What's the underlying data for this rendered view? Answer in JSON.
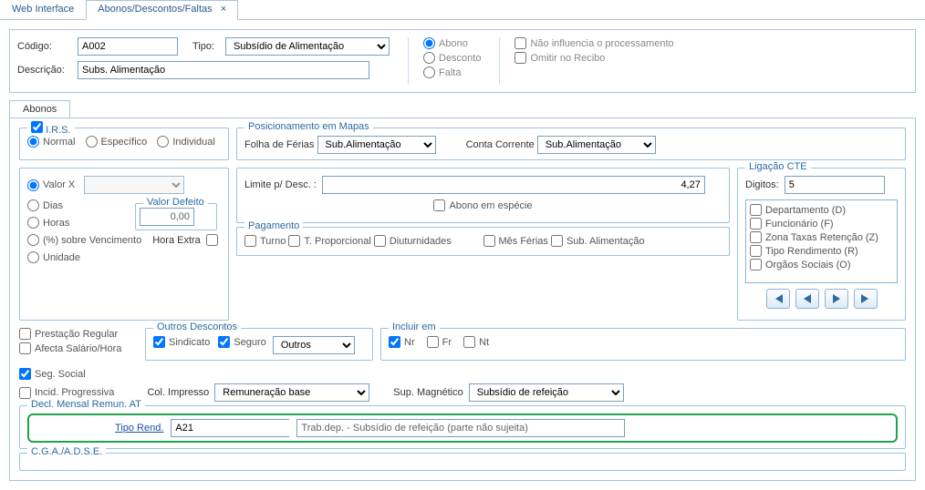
{
  "tabs": {
    "web": "Web Interface",
    "main": "Abonos/Descontos/Faltas"
  },
  "top": {
    "codigo_label": "Código:",
    "codigo_value": "A002",
    "tipo_label": "Tipo:",
    "tipo_value": "Subsídio de Alimentação",
    "descricao_label": "Descrição:",
    "descricao_value": "Subs. Alimentação",
    "rg_abono": "Abono",
    "rg_desconto": "Desconto",
    "rg_falta": "Falta",
    "chk_nao_infl": "Não influencia o processamento",
    "chk_omitir": "Omitir no Recibo"
  },
  "subtab": "Abonos",
  "irs": {
    "legend": "I.R.S.",
    "normal": "Normal",
    "especifico": "Específico",
    "individual": "Individual"
  },
  "mapas": {
    "legend": "Posicionamento em Mapas",
    "folha_label": "Folha de Férias",
    "folha_value": "Sub.Alimentação",
    "conta_label": "Conta Corrente",
    "conta_value": "Sub.Alimentação"
  },
  "valorgrp": {
    "valor_x": "Valor  X",
    "dias": "Dias",
    "horas": "Horas",
    "pct_sobre": "(%) sobre Vencimento",
    "hora_extra": "Hora Extra",
    "unidade": "Unidade",
    "valor_defeito": "Valor Defeito",
    "valor_defeito_val": "0,00"
  },
  "limite": {
    "label": "Limite p/ Desc.   :",
    "value": "4,27",
    "abono_especie": "Abono em espécie"
  },
  "pagamento": {
    "legend": "Pagamento",
    "turno": "Turno",
    "tprop": "T. Proporcional",
    "diut": "Diuturnidades",
    "mesferias": "Mês Férias",
    "subali": "Sub. Alimentação"
  },
  "outros": {
    "prest_reg": "Prestação Regular",
    "afecta": "Afecta Salário/Hora",
    "legend": "Outros Descontos",
    "sindicato": "Sindicato",
    "seguro": "Seguro",
    "sel": "Outros"
  },
  "incluir": {
    "legend": "Incluir em",
    "nr": "Nr",
    "fr": "Fr",
    "nt": "Nt"
  },
  "seg": {
    "seg_social": "Seg. Social",
    "incid_prog": "Incid. Progressiva",
    "col_imp_lbl": "Col. Impresso",
    "col_imp_val": "Remuneração base",
    "sup_mag_lbl": "Sup. Magnético",
    "sup_mag_val": "Subsídio de refeição"
  },
  "decl": {
    "legend": "Decl. Mensal Remun. AT",
    "tipo_rend_lbl": "Tipo Rend.",
    "tipo_rend_val": "A21",
    "tipo_rend_desc": "Trab.dep. - Subsídio de refeição (parte não sujeita)"
  },
  "cga": {
    "legend": "C.G.A./A.D.S.E."
  },
  "cte": {
    "legend": "Ligação CTE",
    "digitos_lbl": "Digitos:",
    "digitos_val": "5",
    "items": [
      "Departamento (D)",
      "Funcionário (F)",
      "Zona Taxas Retenção (Z)",
      "Tipo Rendimento (R)",
      "Orgãos Sociais (O)"
    ]
  }
}
